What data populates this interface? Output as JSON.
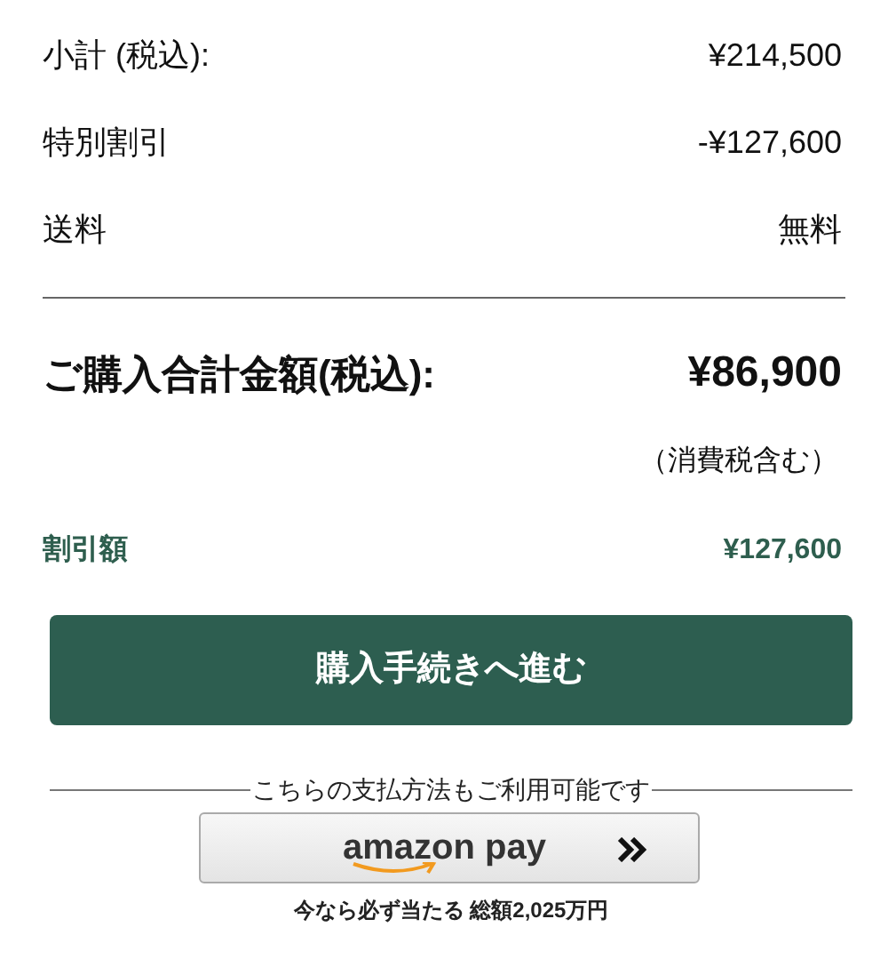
{
  "summary_rows": [
    {
      "label": "小計 (税込):",
      "value": "¥214,500"
    },
    {
      "label": "特別割引",
      "value": "-¥127,600"
    },
    {
      "label": "送料",
      "value": "無料"
    }
  ],
  "total": {
    "label": "ご購入合計金額(税込):",
    "value": "¥86,900",
    "note": "（消費税含む）"
  },
  "discount": {
    "label": "割引額",
    "value": "¥127,600"
  },
  "checkout_button": "購入手続きへ進む",
  "alt_payment": {
    "heading": "こちらの支払方法もご利用可能です",
    "button_label": "amazon pay",
    "promo": "今なら必ず当たる 総額2,025万円"
  }
}
